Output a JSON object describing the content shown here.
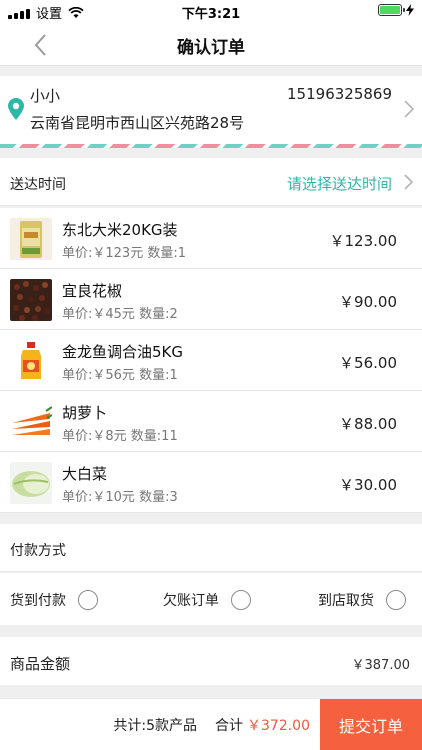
{
  "status_bar": {
    "carrier": "设置",
    "time": "下午3:21",
    "battery_level": 0.9
  },
  "nav": {
    "title": "确认订单"
  },
  "address": {
    "name": "小小",
    "phone": "15196325869",
    "detail": "云南省昆明市西山区兴苑路28号"
  },
  "delivery": {
    "label": "送达时间",
    "placeholder": "请选择送达时间"
  },
  "products": [
    {
      "name": "东北大米20KG装",
      "unit_price": "单价:￥123元",
      "qty": "数量:1",
      "total": "￥123.00",
      "image": "rice-bag"
    },
    {
      "name": "宜良花椒",
      "unit_price": "单价:￥45元",
      "qty": "数量:2",
      "total": "￥90.00",
      "image": "pepper"
    },
    {
      "name": "金龙鱼调合油5KG",
      "unit_price": "单价:￥56元",
      "qty": "数量:1",
      "total": "￥56.00",
      "image": "oil-bottle"
    },
    {
      "name": "胡萝卜",
      "unit_price": "单价:￥8元",
      "qty": "数量:11",
      "total": "￥88.00",
      "image": "carrot"
    },
    {
      "name": "大白菜",
      "unit_price": "单价:￥10元",
      "qty": "数量:3",
      "total": "￥30.00",
      "image": "cabbage"
    }
  ],
  "payment": {
    "title": "付款方式",
    "options": [
      {
        "label": "货到付款",
        "selected": false
      },
      {
        "label": "欠账订单",
        "selected": false
      },
      {
        "label": "到店取货",
        "selected": false
      }
    ]
  },
  "amount": {
    "label": "商品金额",
    "value": "￥387.00"
  },
  "footer": {
    "count": "共计:5款产品",
    "total_label": "合计",
    "total_value": "￥372.00",
    "submit": "提交订单"
  },
  "colors": {
    "accent": "#2cb8a8",
    "primary": "#f5603f"
  }
}
